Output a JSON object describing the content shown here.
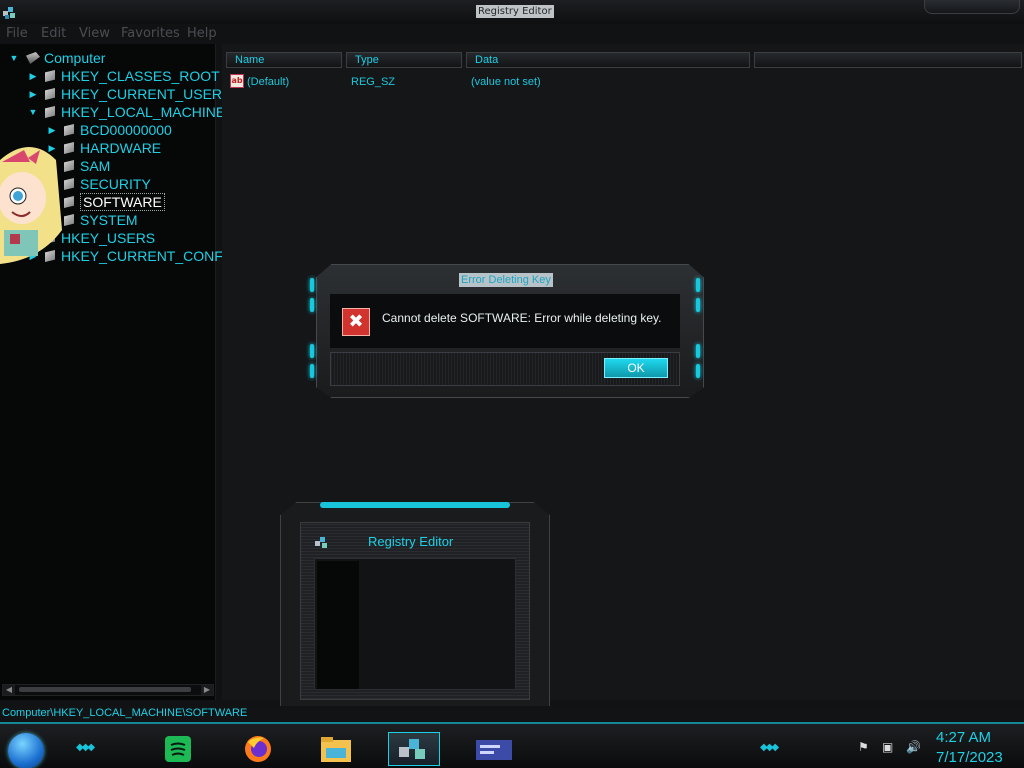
{
  "window": {
    "title": "Registry Editor",
    "menu": [
      "File",
      "Edit",
      "View",
      "Favorites",
      "Help"
    ]
  },
  "tree": {
    "items": [
      {
        "label": "Computer",
        "level": 0
      },
      {
        "label": "HKEY_CLASSES_ROOT",
        "level": 1
      },
      {
        "label": "HKEY_CURRENT_USER",
        "level": 1
      },
      {
        "label": "HKEY_LOCAL_MACHINE",
        "level": 1
      },
      {
        "label": "BCD00000000",
        "level": 2
      },
      {
        "label": "HARDWARE",
        "level": 2
      },
      {
        "label": "SAM",
        "level": 2
      },
      {
        "label": "SECURITY",
        "level": 2
      },
      {
        "label": "SOFTWARE",
        "level": 2,
        "selected": true
      },
      {
        "label": "SYSTEM",
        "level": 2
      },
      {
        "label": "HKEY_USERS",
        "level": 1
      },
      {
        "label": "HKEY_CURRENT_CONFI",
        "level": 1
      }
    ]
  },
  "list": {
    "columns": [
      "Name",
      "Type",
      "Data"
    ],
    "rows": [
      {
        "name": "(Default)",
        "type": "REG_SZ",
        "data": "(value not set)"
      }
    ]
  },
  "dialog": {
    "title": "Error Deleting Key",
    "message": "Cannot delete SOFTWARE:  Error while deleting key.",
    "ok_label": "OK"
  },
  "thumbnail": {
    "title": "Registry Editor"
  },
  "status": {
    "path": "Computer\\HKEY_LOCAL_MACHINE\\SOFTWARE"
  },
  "taskbar": {
    "apps": [
      "spotify-icon",
      "firefox-icon",
      "file-explorer-icon",
      "registry-editor-icon",
      "control-panel-icon"
    ],
    "clock_time": "4:27 AM",
    "clock_date": "7/17/2023"
  },
  "colors": {
    "accent": "#1ed0e6",
    "error": "#d1332e"
  }
}
